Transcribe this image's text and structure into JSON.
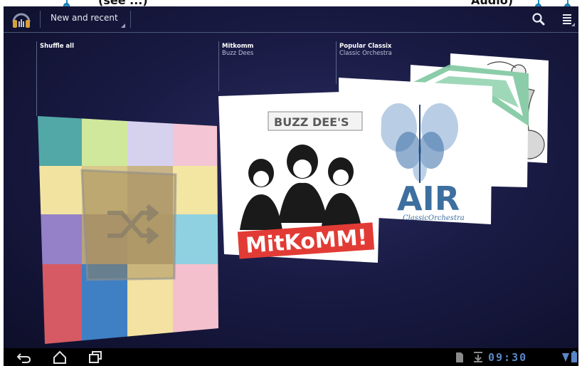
{
  "header": {
    "view_selector_label": "New and recent"
  },
  "annotations": {
    "left_text": "(see ...)",
    "right_text": "Audio)"
  },
  "albums": [
    {
      "title": "Shuffle all",
      "subtitle": ""
    },
    {
      "title": "Mitkomm",
      "subtitle": "Buzz Dees"
    },
    {
      "title": "Popular Classix",
      "subtitle": "Classic Orchestra"
    }
  ],
  "cover_art": {
    "mitkomm_band": "BUZZ DEE'S",
    "mitkomm_title": "MitKoMM!",
    "air_title": "AIR",
    "air_subtitle": "ClassicOrchestra",
    "green_letter": "M"
  },
  "status_bar": {
    "time": "09:30"
  },
  "colors": {
    "callout": "#1f8fc8",
    "clock": "#5a86c8",
    "background": "#1a1b45"
  },
  "icons": {
    "app": "headphones-icon",
    "search": "search-icon",
    "menu": "menu-icon",
    "back": "back-icon",
    "home": "home-icon",
    "recents": "recent-apps-icon",
    "sd": "sd-card-icon",
    "download": "download-icon",
    "wifi": "wifi-icon",
    "battery": "battery-icon"
  }
}
